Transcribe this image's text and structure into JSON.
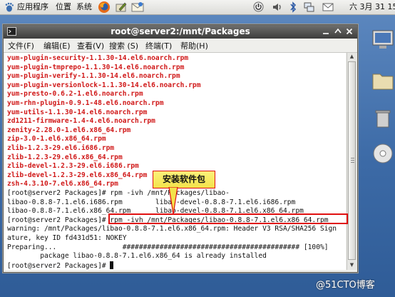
{
  "panel": {
    "menus": [
      "应用程序",
      "位置",
      "系统"
    ],
    "clock": "六 3月 31 15",
    "icons": [
      "foot-icon",
      "firefox-icon",
      "edit-icon",
      "mail-icon",
      "power-icon",
      "speaker-icon",
      "bluetooth-icon",
      "network-icon",
      "mail-tray-icon"
    ]
  },
  "window": {
    "title": "root@server2:/mnt/Packages",
    "menu": [
      "文件(F)",
      "编辑(E)",
      "查看(V)",
      "搜索 (S)",
      "终端(T)",
      "帮助(H)"
    ],
    "controls": [
      "minimize",
      "maximize",
      "close"
    ]
  },
  "terminal": {
    "lines": [
      {
        "text": "yum-plugin-security-1.1.30-14.el6.noarch.rpm",
        "red": true
      },
      {
        "text": "yum-plugin-tmprepo-1.1.30-14.el6.noarch.rpm",
        "red": true
      },
      {
        "text": "yum-plugin-verify-1.1.30-14.el6.noarch.rpm",
        "red": true
      },
      {
        "text": "yum-plugin-versionlock-1.1.30-14.el6.noarch.rpm",
        "red": true
      },
      {
        "text": "yum-presto-0.6.2-1.el6.noarch.rpm",
        "red": true
      },
      {
        "text": "yum-rhn-plugin-0.9.1-48.el6.noarch.rpm",
        "red": true
      },
      {
        "text": "yum-utils-1.1.30-14.el6.noarch.rpm",
        "red": true
      },
      {
        "text": "zd1211-firmware-1.4-4.el6.noarch.rpm",
        "red": true
      },
      {
        "text": "zenity-2.28.0-1.el6.x86_64.rpm",
        "red": true
      },
      {
        "text": "zip-3.0-1.el6.x86_64.rpm",
        "red": true
      },
      {
        "text": "zlib-1.2.3-29.el6.i686.rpm",
        "red": true
      },
      {
        "text": "zlib-1.2.3-29.el6.x86_64.rpm",
        "red": true
      },
      {
        "text": "zlib-devel-1.2.3-29.el6.i686.rpm",
        "red": true
      },
      {
        "text": "zlib-devel-1.2.3-29.el6.x86_64.rpm",
        "red": true
      },
      {
        "text": "zsh-4.3.10-7.el6.x86_64.rpm",
        "red": true
      },
      {
        "text": "[root@server2 Packages]# rpm -ivh /mnt/Packages/libao-",
        "red": false
      },
      {
        "text": "libao-0.8.8-7.1.el6.i686.rpm        libao-devel-0.8.8-7.1.el6.i686.rpm",
        "red": false
      },
      {
        "text": "libao-0.8.8-7.1.el6.x86_64.rpm      libao-devel-0.8.8-7.1.el6.x86_64.rpm",
        "red": false
      },
      {
        "text": "[root@server2 Packages]# rpm -ivh /mnt/Packages/libao-0.8.8-7.1.el6.x86_64.rpm",
        "red": false
      },
      {
        "text": "warning: /mnt/Packages/libao-0.8.8-7.1.el6.x86_64.rpm: Header V3 RSA/SHA256 Sign",
        "red": false
      },
      {
        "text": "ature, key ID fd431d51: NOKEY",
        "red": false
      },
      {
        "text": "Preparing...                ########################################### [100%]",
        "red": false
      },
      {
        "text": "        package libao-0.8.8-7.1.el6.x86_64 is already installed",
        "red": false
      },
      {
        "text": "[root@server2 Packages]# ",
        "red": false
      }
    ]
  },
  "annotation": {
    "callout": "安装软件包"
  },
  "watermark": "@51CTO博客"
}
